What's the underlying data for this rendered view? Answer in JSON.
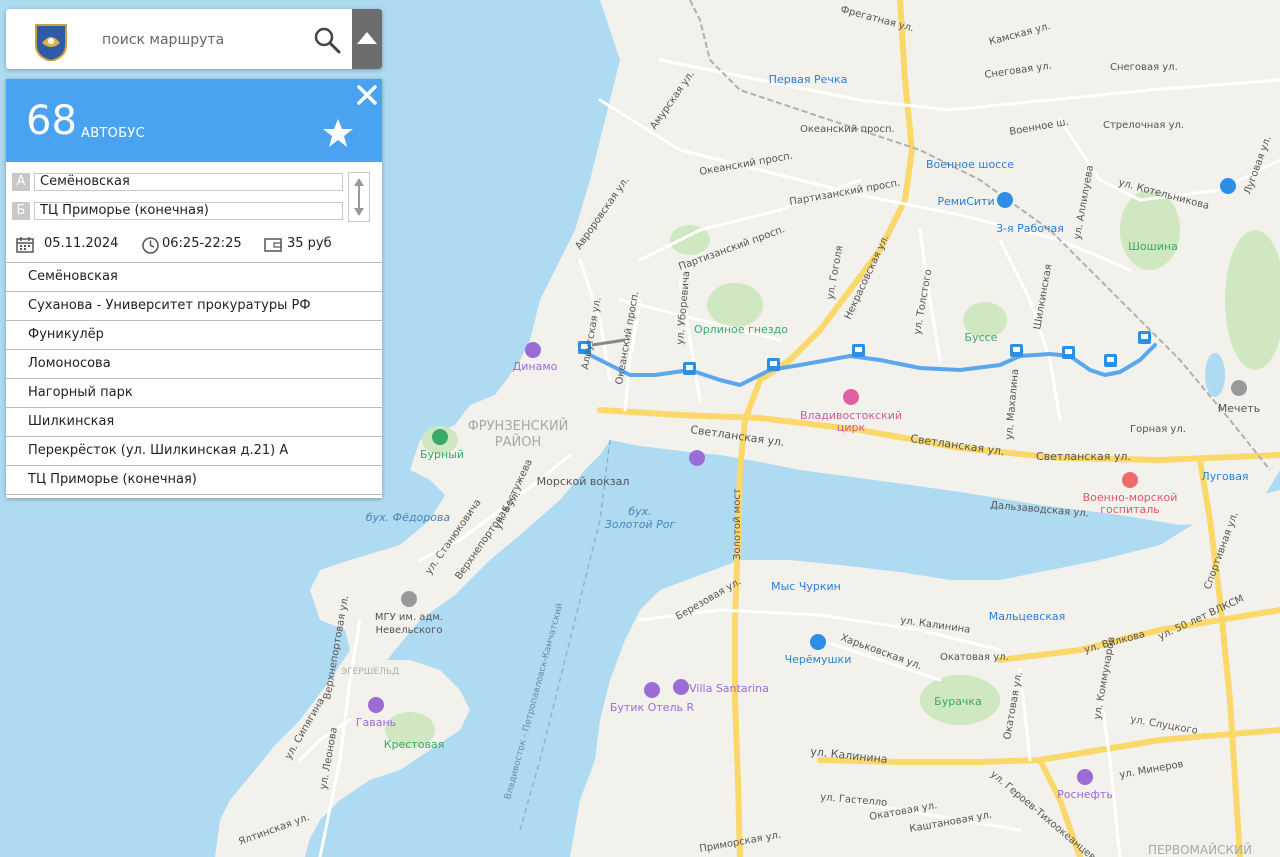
{
  "search": {
    "placeholder": "поиск маршрута"
  },
  "route": {
    "number": "68",
    "type": "АВТОБУС",
    "point_a_letter": "А",
    "point_b_letter": "Б",
    "from": "Семёновская",
    "to": "ТЦ Приморье (конечная)",
    "date": "05.11.2024",
    "hours": "06:25-22:25",
    "price": "35 руб"
  },
  "stops": [
    "Семёновская",
    "Суханова - Университет прокуратуры РФ",
    "Фуникулёр",
    "Ломоносова",
    "Нагорный парк",
    "Шилкинская",
    "Перекрёсток (ул. Шилкинская д.21) А",
    "ТЦ Приморье (конечная)"
  ],
  "map": {
    "districts": [
      "ФРУНЗЕНСКИЙ",
      "РАЙОН",
      "ЭГЕРШЕЛЬД",
      "ПЕРВОМАЙСКИЙ"
    ],
    "bays": [
      "бух. Фёдорова",
      "бух.",
      "Золотой Рог"
    ],
    "pois": [
      "Динамо",
      "Орлиное гнездо",
      "Бурный",
      "Морской вокзал",
      "Владивостокский",
      "цирк",
      "Буссе",
      "Шошина",
      "Мечеть",
      "Луговая",
      "Военно-морской",
      "госпиталь",
      "Первая Речка",
      "Военное шоссе",
      "РемиСити",
      "3-я Рабочая",
      "Мыс Чуркин",
      "Мальцевская",
      "Черёмушки",
      "Бутик Отель R",
      "Villa Santarina",
      "Бурачка",
      "Роснефть",
      "МГУ им. адм.",
      "Невельского",
      "Гавань",
      "Крестовая"
    ],
    "streets": [
      "Светланская ул.",
      "Светланская ул.",
      "Светланская ул.",
      "Алеутская ул.",
      "Океанский просп.",
      "Океанский просп.",
      "Океанский просп.",
      "Партизанский просп.",
      "Партизанский просп.",
      "ул. Гоголя",
      "Некрасовская ул.",
      "Снеговая ул.",
      "Снеговая ул.",
      "ул. Котельникова",
      "Стрелочная ул.",
      "Луговая ул.",
      "Шилкинская",
      "Горная ул.",
      "Дальзаводская ул.",
      "Спортивная ул.",
      "ул. Вилкова",
      "ул. 50 лет ВЛКСМ",
      "ул. Калинина",
      "ул. Калинина",
      "Окатовая ул.",
      "Окатовая ул.",
      "Окатовая ул.",
      "Харьковская ул.",
      "Березовая ул.",
      "Золотой мост",
      "ул. Героев-Тихоокеанцев",
      "ул. Коммунаров",
      "ул. Слуцкого",
      "ул. Минеров",
      "ул. Гастелло",
      "Каштановая ул.",
      "Приморская ул.",
      "ул. Станюковича",
      "Верхнепортовая ул.",
      "ул. Бестужева",
      "Верхнепортовая ул.",
      "ул. Сипягина",
      "ул. Леонова",
      "Ялтинская ул.",
      "Амурская ул.",
      "Авроровская ул.",
      "ул. Уборевича",
      "ул. Толстого",
      "ул. Махалина",
      "ул. Аллилуева",
      "Камская ул.",
      "Фрегатная ул.",
      "Военное ш.",
      "Владивосток - Петропавловск-Камчатский"
    ]
  }
}
